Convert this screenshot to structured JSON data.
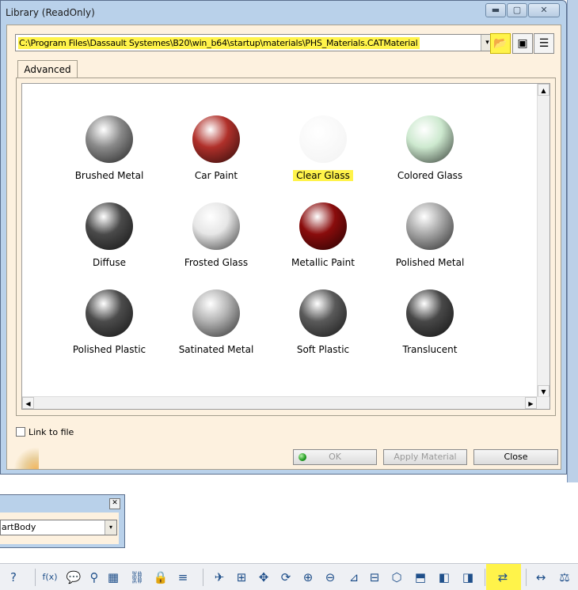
{
  "window": {
    "title": "Library (ReadOnly)",
    "min_glyph": "▬",
    "max_glyph": "▢",
    "close_glyph": "✕"
  },
  "path": {
    "value": "C:\\Program Files\\Dassault Systemes\\B20\\win_b64\\startup\\materials\\PHS_Materials.CATMaterial",
    "dropdown_glyph": "▾"
  },
  "toolbar_buttons": {
    "open_icon": "folder-open-icon",
    "open_glyph": "📂",
    "icons_view_glyph": "▣",
    "list_view_glyph": "☰"
  },
  "tabs": [
    {
      "label": "Advanced"
    }
  ],
  "materials": [
    {
      "label": "Brushed Metal",
      "color": "#8a8a8a"
    },
    {
      "label": "Car Paint",
      "color": "#b0302a"
    },
    {
      "label": "Clear Glass",
      "color": "#f6f6f6",
      "selected": true
    },
    {
      "label": "Colored Glass",
      "color": "#cde9cf"
    },
    {
      "label": "Diffuse",
      "color": "#4a4a4a"
    },
    {
      "label": "Frosted Glass",
      "color": "#e6e6e6"
    },
    {
      "label": "Metallic Paint",
      "color": "#8a0c0c"
    },
    {
      "label": "Polished Metal",
      "color": "#a8a8a8"
    },
    {
      "label": "Polished Plastic",
      "color": "#4c4c4c"
    },
    {
      "label": "Satinated Metal",
      "color": "#b4b4b4"
    },
    {
      "label": "Soft Plastic",
      "color": "#5a5a5a"
    },
    {
      "label": "Translucent",
      "color": "#484848"
    }
  ],
  "scroll": {
    "up": "▲",
    "down": "▼",
    "left": "◀",
    "right": "▶"
  },
  "footer": {
    "link_to_file": "Link to file",
    "ok": "OK",
    "apply": "Apply Material",
    "close": "Close"
  },
  "background_panel": {
    "close_glyph": "✕",
    "selected_body": "artBody",
    "dropdown_glyph": "▾"
  },
  "bottom_toolbar": [
    {
      "name": "help-icon",
      "glyph": "?"
    },
    {
      "name": "formula-icon",
      "glyph": "f(x)"
    },
    {
      "name": "chat-icon",
      "glyph": "💬"
    },
    {
      "name": "parameter-icon",
      "glyph": "⚲"
    },
    {
      "name": "table-icon",
      "glyph": "▦"
    },
    {
      "name": "tree-icon",
      "glyph": "⛓"
    },
    {
      "name": "lock-icon",
      "glyph": "🔒"
    },
    {
      "name": "rules-icon",
      "glyph": "≡"
    },
    {
      "name": "fly-icon",
      "glyph": "✈"
    },
    {
      "name": "fit-all-icon",
      "glyph": "⊞"
    },
    {
      "name": "pan-icon",
      "glyph": "✥"
    },
    {
      "name": "rotate-icon",
      "glyph": "⟳"
    },
    {
      "name": "zoom-in-icon",
      "glyph": "⊕"
    },
    {
      "name": "zoom-out-icon",
      "glyph": "⊖"
    },
    {
      "name": "normal-view-icon",
      "glyph": "⊿"
    },
    {
      "name": "multi-view-icon",
      "glyph": "⊟"
    },
    {
      "name": "iso-view-icon",
      "glyph": "⬡"
    },
    {
      "name": "render-style-icon",
      "glyph": "⬒"
    },
    {
      "name": "hide-show-icon",
      "glyph": "◧"
    },
    {
      "name": "swap-visible-icon",
      "glyph": "◨"
    },
    {
      "name": "apply-material-icon",
      "glyph": "⇄"
    },
    {
      "name": "measure-icon",
      "glyph": "↔"
    },
    {
      "name": "inertia-icon",
      "glyph": "⚖"
    }
  ]
}
